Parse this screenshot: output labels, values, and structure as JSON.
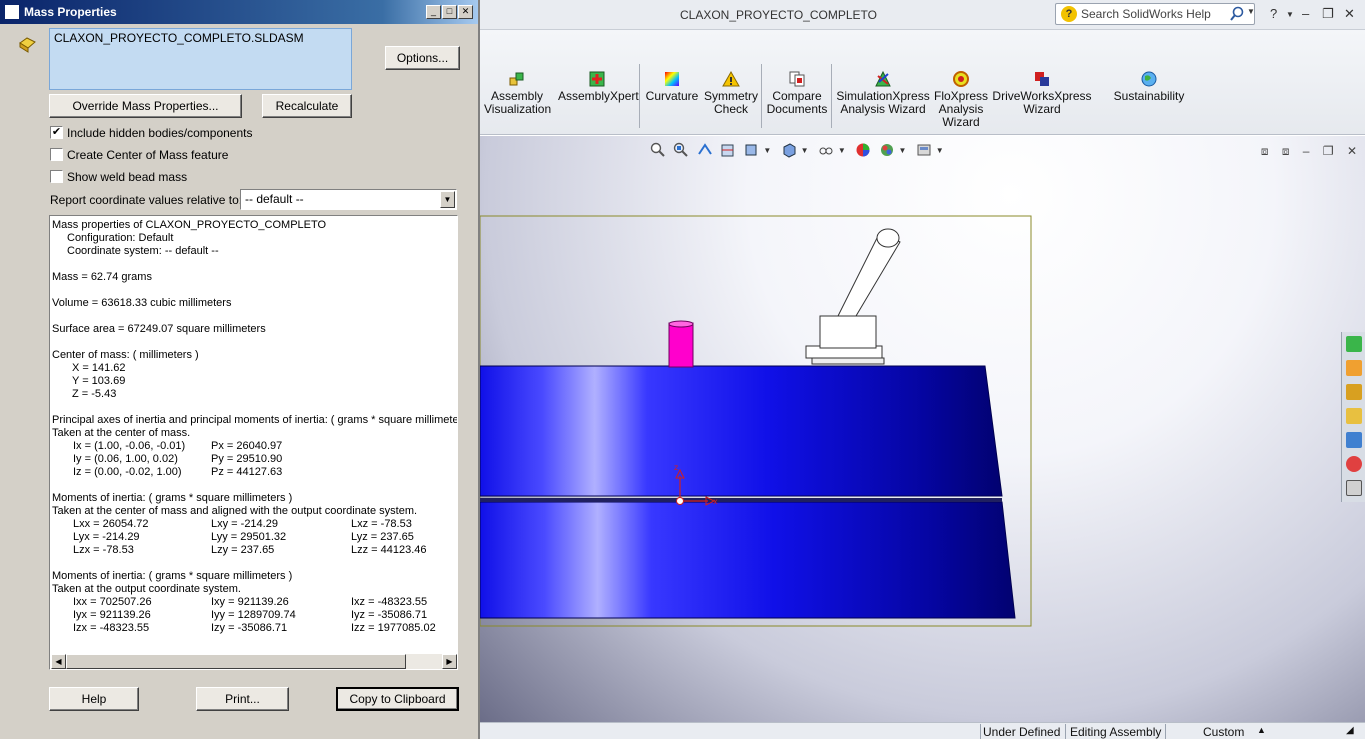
{
  "dialog": {
    "title": "Mass Properties",
    "file_name": "CLAXON_PROYECTO_COMPLETO.SLDASM",
    "options_label": "Options...",
    "override_label": "Override Mass Properties...",
    "recalculate_label": "Recalculate",
    "include_hidden_label": "Include hidden bodies/components",
    "include_hidden_checked": "✔",
    "center_of_mass_label": "Create Center of Mass feature",
    "weld_bead_label": "Show weld bead mass",
    "coord_label": "Report coordinate values relative to:",
    "coord_value": "-- default --",
    "help_label": "Help",
    "print_label": "Print...",
    "copy_label": "Copy to Clipboard",
    "results": {
      "header": "Mass properties of CLAXON_PROYECTO_COMPLETO",
      "configuration": "Configuration: Default",
      "coord_system": "Coordinate system: -- default --",
      "mass": "Mass = 62.74 grams",
      "volume": "Volume = 63618.33 cubic millimeters",
      "surface_area": "Surface area = 67249.07  square millimeters",
      "com_header": "Center of mass: ( millimeters )",
      "com_x": "X = 141.62",
      "com_y": "Y = 103.69",
      "com_z": "Z = -5.43",
      "principal_header": "Principal axes of inertia and principal moments of inertia: ( grams *  square millimeters )",
      "principal_taken": "Taken at the center of mass.",
      "ix": "Ix = (1.00, -0.06, -0.01)",
      "iy": "Iy = (0.06, 1.00, 0.02)",
      "iz": "Iz = (0.00, -0.02, 1.00)",
      "px": "Px = 26040.97",
      "py": "Py = 29510.90",
      "pz": "Pz = 44127.63",
      "moi1_header": "Moments of inertia: ( grams *  square millimeters )",
      "moi1_taken": "Taken at the center of mass and aligned with the output coordinate system.",
      "lxx": "Lxx = 26054.72",
      "lxy": "Lxy = -214.29",
      "lxz": "Lxz = -78.53",
      "lyx": "Lyx = -214.29",
      "lyy": "Lyy = 29501.32",
      "lyz": "Lyz = 237.65",
      "lzx": "Lzx = -78.53",
      "lzy": "Lzy = 237.65",
      "lzz": "Lzz = 44123.46",
      "moi2_header": "Moments of inertia: ( grams *  square millimeters )",
      "moi2_taken": "Taken at the output coordinate system.",
      "ixx": "Ixx = 702507.26",
      "ixy": "Ixy = 921139.26",
      "ixz": "Ixz = -48323.55",
      "iyx": "Iyx = 921139.26",
      "iyy": "Iyy = 1289709.74",
      "iyz": "Iyz = -35086.71",
      "izx": "Izx = -48323.55",
      "izy": "Izy = -35086.71",
      "izz": "Izz = 1977085.02"
    }
  },
  "window": {
    "title": "CLAXON_PROYECTO_COMPLETO",
    "search_placeholder": "Search SolidWorks Help"
  },
  "commands": {
    "assembly_visualization": [
      "Assembly",
      "Visualization"
    ],
    "assemblyxpert": "AssemblyXpert",
    "curvature": "Curvature",
    "symmetry_check": [
      "Symmetry",
      "Check"
    ],
    "compare_documents": [
      "Compare",
      "Documents"
    ],
    "simulationxpress": [
      "SimulationXpress",
      "Analysis Wizard"
    ],
    "floxpress": [
      "FloXpress",
      "Analysis",
      "Wizard"
    ],
    "driveworksxpress": [
      "DriveWorksXpress",
      "Wizard"
    ],
    "sustainability": "Sustainability"
  },
  "status": {
    "under_defined": "Under Defined",
    "editing": "Editing Assembly",
    "units": "Custom"
  },
  "triad": {
    "x_label": "x",
    "z_label": "z"
  },
  "colors": {
    "model_blue": "#1a1aff",
    "button_magenta": "#ff00cc",
    "title_blue": "#0a246a"
  }
}
